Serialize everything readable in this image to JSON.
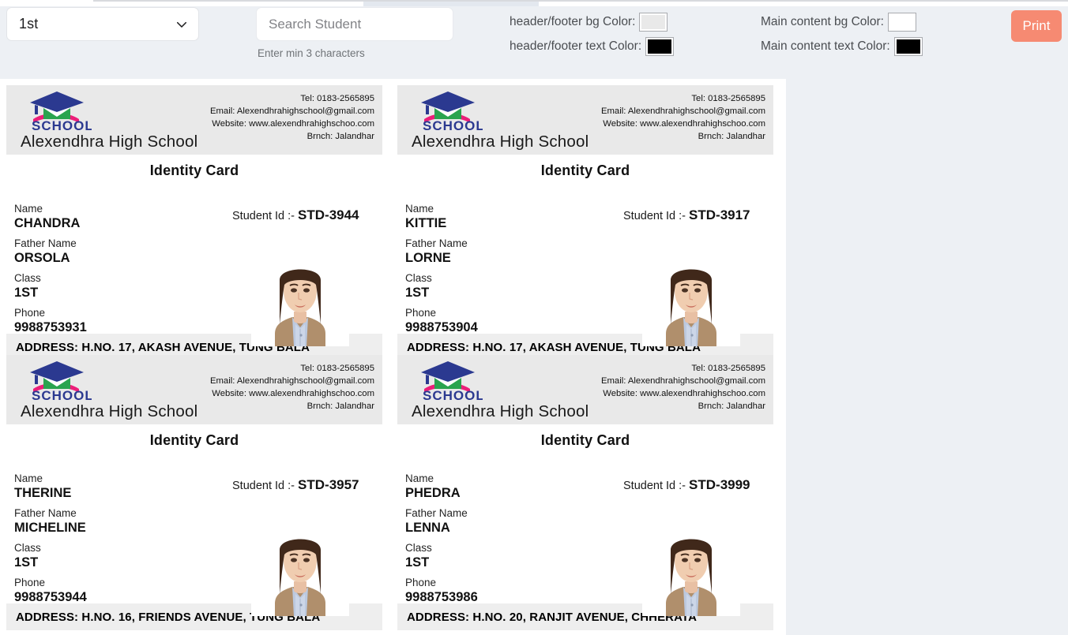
{
  "toolbar": {
    "class_select": {
      "value": "1st",
      "icon": "chevron-down-icon"
    },
    "search": {
      "value": "",
      "placeholder": "Search Student",
      "hint": "Enter min 3 characters"
    },
    "color_controls": [
      {
        "label": "header/footer bg Color:",
        "color": "#e9e9e9"
      },
      {
        "label": "header/footer text Color:",
        "color": "#000000"
      },
      {
        "label": "Main content bg Color:",
        "color": "#ffffff"
      },
      {
        "label": "Main content text Color:",
        "color": "#000000"
      }
    ],
    "print_label": "Print",
    "print_color": "#f68a72"
  },
  "school": {
    "name": "Alexendhra High School",
    "logo_text": "SCHOOL",
    "tel": "Tel: 0183-2565895",
    "email": "Email: Alexendhrahighschool@gmail.com",
    "website": "Website: www.alexendhrahighschoo.com",
    "branch": "Brnch: Jalandhar"
  },
  "card": {
    "title": "Identity Card",
    "label_name": "Name",
    "label_father": "Father Name",
    "label_class": "Class",
    "label_phone": "Phone",
    "label_student_id": "Student Id :-"
  },
  "students": [
    {
      "name": "CHANDRA",
      "father_name": "ORSOLA",
      "class": "1ST",
      "phone": "9988753931",
      "student_id": "STD-3944",
      "address": "ADDRESS: H.NO. 17, AKASH AVENUE, TUNG BALA"
    },
    {
      "name": "KITTIE",
      "father_name": "LORNE",
      "class": "1ST",
      "phone": "9988753904",
      "student_id": "STD-3917",
      "address": "ADDRESS: H.NO. 17, AKASH AVENUE, TUNG BALA"
    },
    {
      "name": "THERINE",
      "father_name": "MICHELINE",
      "class": "1ST",
      "phone": "9988753944",
      "student_id": "STD-3957",
      "address": "ADDRESS: H.NO. 16, FRIENDS AVENUE, TUNG BALA"
    },
    {
      "name": "PHEDRA",
      "father_name": "LENNA",
      "class": "1ST",
      "phone": "9988753986",
      "student_id": "STD-3999",
      "address": "ADDRESS: H.NO. 20, RANJIT AVENUE, CHHERATA"
    }
  ]
}
